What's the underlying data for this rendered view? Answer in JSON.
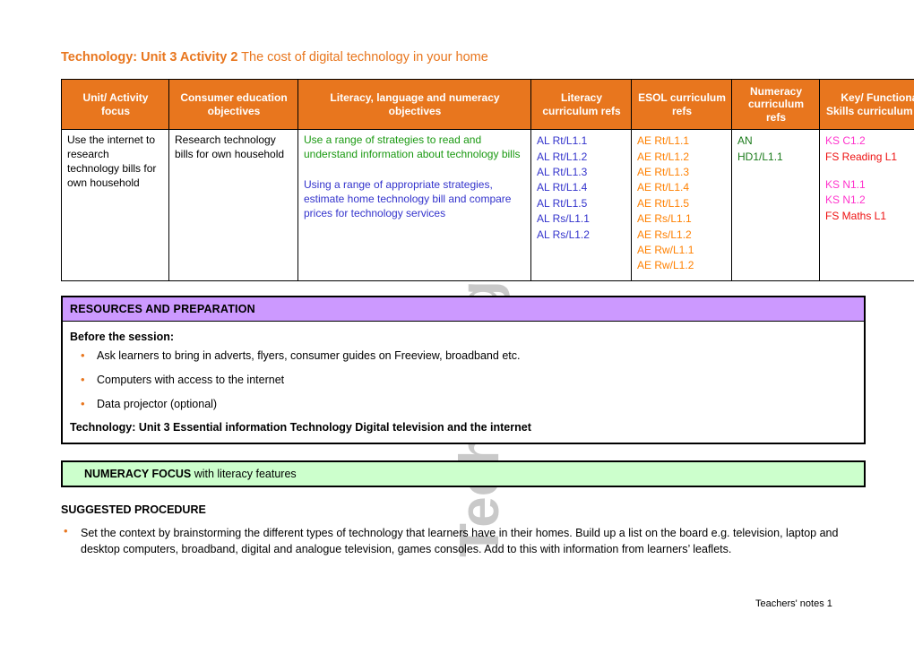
{
  "document": {
    "title_bold": "Technology: Unit 3 Activity 2",
    "title_rest": " The cost of digital technology in your home",
    "watermark": "Technology",
    "footer": "Teachers' notes 1",
    "accent_orange": "#E8761E",
    "purple_band": "#CC99FF",
    "green_band": "#CCFFCC"
  },
  "main_table": {
    "headers": [
      "Unit/ Activity focus",
      "Consumer education objectives",
      "Literacy, language and numeracy objectives",
      "Literacy curriculum refs",
      "ESOL curriculum refs",
      "Numeracy curriculum refs",
      "Key/ Functional Skills curriculum refs"
    ],
    "row": {
      "unit_activity_focus": "Use the internet to research technology bills for own household",
      "consumer_education_objectives": "Research technology bills for own household",
      "literacy_objectives_green": "Use a range of strategies to read and understand information about technology bills",
      "literacy_objectives_blue": "Using a range of appropriate strategies, estimate home technology bill and compare prices for technology services",
      "literacy_refs": [
        "AL Rt/L1.1",
        "AL Rt/L1.2",
        "AL Rt/L1.3",
        "AL Rt/L1.4",
        "AL Rt/L1.5",
        "AL Rs/L1.1",
        "AL Rs/L1.2"
      ],
      "esol_refs": [
        "AE Rt/L1.1",
        "AE Rt/L1.2",
        "AE Rt/L1.3",
        "AE Rt/L1.4",
        "AE Rt/L1.5",
        "AE Rs/L1.1",
        "AE Rs/L1.2",
        "AE Rw/L1.1",
        "AE Rw/L1.2"
      ],
      "numeracy_refs": [
        "AN",
        "HD1/L1.1"
      ],
      "key_skills_refs_group1": [
        {
          "text": "KS C1.2",
          "color": "magenta"
        },
        {
          "text": "FS Reading L1",
          "color": "red"
        }
      ],
      "key_skills_refs_group2": [
        {
          "text": "KS N1.1",
          "color": "magenta"
        },
        {
          "text": "KS N1.2",
          "color": "magenta"
        },
        {
          "text": "FS Maths L1",
          "color": "red"
        }
      ]
    }
  },
  "resources": {
    "heading": "RESOURCES AND PREPARATION",
    "subheading": "Before the session:",
    "bullets": [
      "Ask learners to bring in adverts, flyers, consumer guides on Freeview, broadband etc.",
      "Computers with access to the internet",
      "Data projector (optional)"
    ],
    "footline": "Technology: Unit 3 Essential information Technology Digital television and the internet"
  },
  "focus_banner": {
    "strong": "NUMERACY FOCUS",
    "rest": " with literacy features"
  },
  "procedure": {
    "heading": "SUGGESTED PROCEDURE",
    "bullets": [
      "Set the context by brainstorming the different types of technology that learners have in their homes. Build up a list on the board e.g. television, laptop and desktop computers, broadband, digital and analogue television, games consoles. Add to this with information from learners’ leaflets."
    ]
  }
}
